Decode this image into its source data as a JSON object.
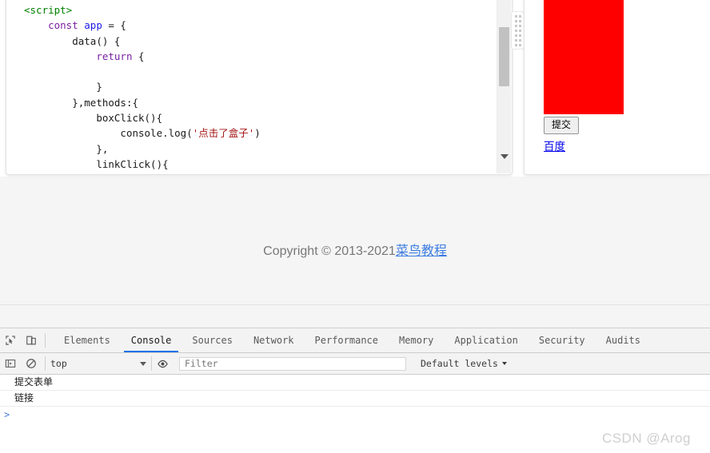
{
  "page": {
    "code_panel": {
      "lines": [
        {
          "indent": 0,
          "parts": [
            {
              "t": "tag",
              "s": "<script>"
            }
          ]
        },
        {
          "indent": 1,
          "parts": [
            {
              "t": "kw",
              "s": "const"
            },
            {
              "t": "plain",
              "s": " "
            },
            {
              "t": "var",
              "s": "app"
            },
            {
              "t": "plain",
              "s": " = {"
            }
          ]
        },
        {
          "indent": 2,
          "parts": [
            {
              "t": "plain",
              "s": "data() {"
            }
          ]
        },
        {
          "indent": 3,
          "parts": [
            {
              "t": "kw",
              "s": "return"
            },
            {
              "t": "plain",
              "s": " {"
            }
          ]
        },
        {
          "indent": 0,
          "parts": []
        },
        {
          "indent": 3,
          "parts": [
            {
              "t": "plain",
              "s": "}"
            }
          ]
        },
        {
          "indent": 2,
          "parts": [
            {
              "t": "plain",
              "s": "},methods:{"
            }
          ]
        },
        {
          "indent": 3,
          "parts": [
            {
              "t": "plain",
              "s": "boxClick(){"
            }
          ]
        },
        {
          "indent": 4,
          "parts": [
            {
              "t": "plain",
              "s": "console.log("
            },
            {
              "t": "str",
              "s": "'点击了盒子'"
            },
            {
              "t": "plain",
              "s": ")"
            }
          ]
        },
        {
          "indent": 3,
          "parts": [
            {
              "t": "plain",
              "s": "},"
            }
          ]
        },
        {
          "indent": 3,
          "parts": [
            {
              "t": "plain",
              "s": "linkClick(){"
            }
          ]
        }
      ],
      "scrollbar": {
        "name": "vertical-scrollbar"
      }
    },
    "preview_panel": {
      "red_box_color": "#ff0000",
      "submit_button": "提交",
      "link": "百度"
    },
    "footer": {
      "copyright_text": "Copyright © 2013-2021",
      "copyright_link": "菜鸟教程"
    }
  },
  "devtools": {
    "tabs": [
      {
        "label": "Elements",
        "active": false
      },
      {
        "label": "Console",
        "active": true
      },
      {
        "label": "Sources",
        "active": false
      },
      {
        "label": "Network",
        "active": false
      },
      {
        "label": "Performance",
        "active": false
      },
      {
        "label": "Memory",
        "active": false
      },
      {
        "label": "Application",
        "active": false
      },
      {
        "label": "Security",
        "active": false
      },
      {
        "label": "Audits",
        "active": false
      }
    ],
    "toolbar": {
      "inspect_icon": "inspect-element-icon",
      "device_icon": "device-toolbar-icon"
    },
    "filterbar": {
      "sidebar_icon": "console-sidebar-icon",
      "clear_icon": "clear-console-icon",
      "context": "top",
      "eye_icon": "live-expression-icon",
      "filter_placeholder": "Filter",
      "levels": "Default levels"
    },
    "console_messages": [
      "提交表单",
      "链接"
    ],
    "prompt": ">"
  },
  "watermark": "CSDN @Arog"
}
